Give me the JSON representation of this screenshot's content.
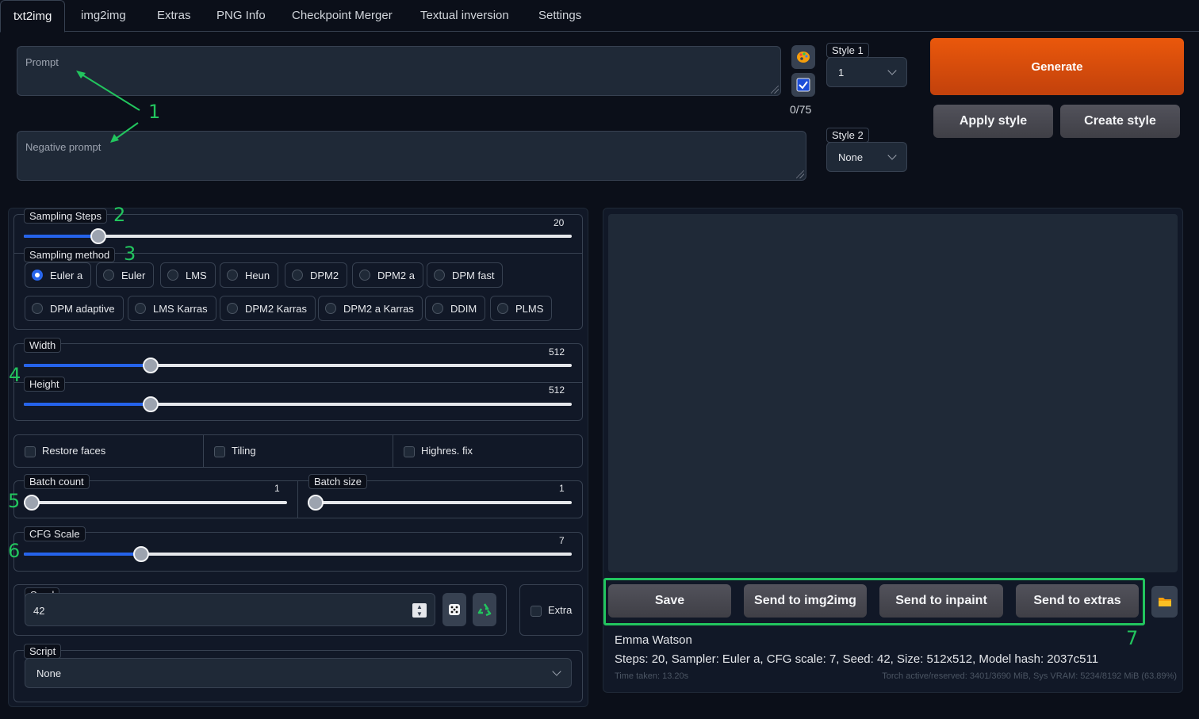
{
  "tabs": [
    "txt2img",
    "img2img",
    "Extras",
    "PNG Info",
    "Checkpoint Merger",
    "Textual inversion",
    "Settings"
  ],
  "prompt": {
    "placeholder": "Prompt",
    "token_count": "0/75"
  },
  "negative_prompt": {
    "placeholder": "Negative prompt"
  },
  "style1": {
    "label": "Style 1",
    "value": "1"
  },
  "style2": {
    "label": "Style 2",
    "value": "None"
  },
  "buttons": {
    "generate": "Generate",
    "apply_style": "Apply style",
    "create_style": "Create style"
  },
  "icons": {
    "paint": "palette-icon",
    "check": "checkbox-icon",
    "dice": "dice-icon",
    "recycle": "recycle-icon",
    "folder": "folder-icon"
  },
  "sampling_steps": {
    "label": "Sampling Steps",
    "value": "20",
    "fraction": 0.13
  },
  "sampling_method": {
    "label": "Sampling method",
    "options": [
      "Euler a",
      "Euler",
      "LMS",
      "Heun",
      "DPM2",
      "DPM2 a",
      "DPM fast",
      "DPM adaptive",
      "LMS Karras",
      "DPM2 Karras",
      "DPM2 a Karras",
      "DDIM",
      "PLMS"
    ],
    "selected": "Euler a"
  },
  "width": {
    "label": "Width",
    "value": "512",
    "fraction": 0.23
  },
  "height": {
    "label": "Height",
    "value": "512",
    "fraction": 0.23
  },
  "checkboxes": {
    "restore_faces": "Restore faces",
    "tiling": "Tiling",
    "highres": "Highres. fix"
  },
  "batch_count": {
    "label": "Batch count",
    "value": "1"
  },
  "batch_size": {
    "label": "Batch size",
    "value": "1"
  },
  "cfg_scale": {
    "label": "CFG Scale",
    "value": "7",
    "fraction": 0.21
  },
  "seed": {
    "label": "Seed",
    "value": "42"
  },
  "extra": {
    "label": "Extra"
  },
  "script": {
    "label": "Script",
    "value": "None"
  },
  "output_buttons": {
    "save": "Save",
    "send_img2img": "Send to img2img",
    "send_inpaint": "Send to inpaint",
    "send_extras": "Send to extras"
  },
  "info": {
    "prompt_text": "Emma Watson",
    "params": "Steps: 20, Sampler: Euler a, CFG scale: 7, Seed: 42, Size: 512x512, Model hash: 2037c511",
    "time": "Time taken: 13.20s",
    "vram": "Torch active/reserved: 3401/3690 MiB, Sys VRAM: 5234/8192 MiB (63.89%)"
  },
  "annotations": [
    "1",
    "2",
    "3",
    "4",
    "5",
    "6",
    "7"
  ],
  "colors": {
    "accent": "#2563eb",
    "generate": "#ea580c",
    "annotation": "#22c55e"
  }
}
